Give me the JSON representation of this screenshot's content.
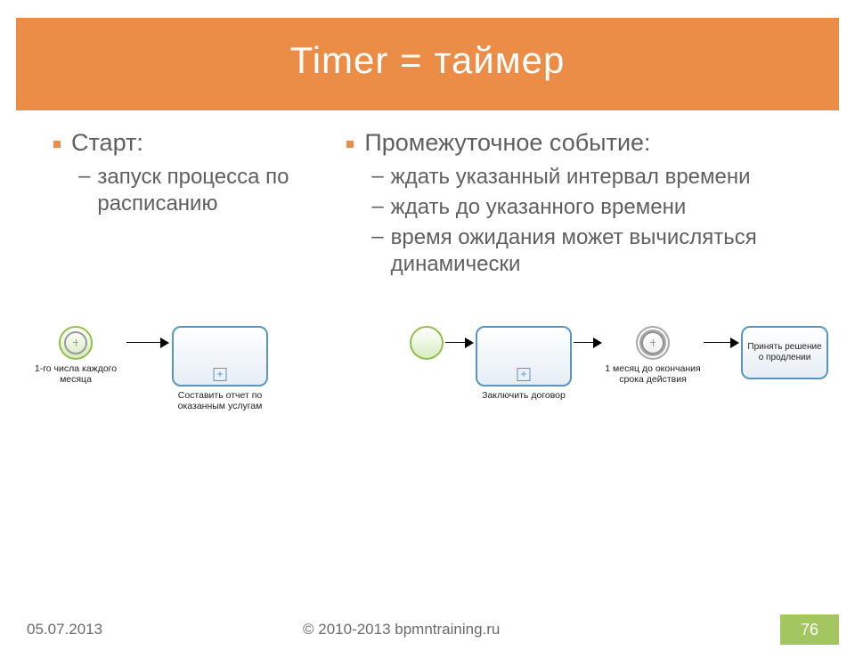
{
  "title": "Timer = таймер",
  "left": {
    "heading": "Старт:",
    "items": [
      "запуск процесса по расписанию"
    ]
  },
  "right": {
    "heading": "Промежуточное событие:",
    "items": [
      "ждать указанный интервал времени",
      "ждать до указанного времени",
      "время ожидания может вычисляться динамически"
    ]
  },
  "diagram_left": {
    "start_label": "1-го числа каждого месяца",
    "task_label": "Составить отчет по оказанным услугам"
  },
  "diagram_right": {
    "task1_label": "Заключить договор",
    "timer_label": "1 месяц до окончания срока действия",
    "task2_label": "Принять решение о продлении"
  },
  "footer": {
    "date": "05.07.2013",
    "copyright": "© 2010-2013 bpmntraining.ru",
    "page": "76"
  }
}
